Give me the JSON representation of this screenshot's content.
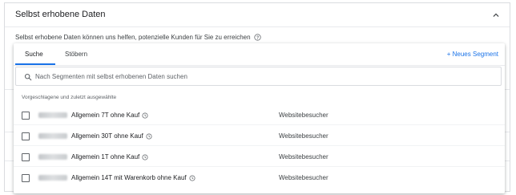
{
  "panel": {
    "title": "Selbst erhobene Daten",
    "description": "Selbst erhobene Daten können uns helfen, potenzielle Kunden für Sie zu erreichen"
  },
  "tabs": [
    {
      "label": "Suche",
      "active": true
    },
    {
      "label": "Stöbern",
      "active": false
    }
  ],
  "new_segment_label": "+ Neues Segment",
  "search": {
    "placeholder": "Nach Segmenten mit selbst erhobenen Daten suchen",
    "value": ""
  },
  "section_label": "Vorgeschlagene und zuletzt ausgewählte",
  "rows": [
    {
      "name": "Allgemein 7T ohne Kauf",
      "type": "Websitebesucher",
      "checked": false
    },
    {
      "name": "Allgemein 30T ohne Kauf",
      "type": "Websitebesucher",
      "checked": false
    },
    {
      "name": "Allgemein 1T ohne Kauf",
      "type": "Websitebesucher",
      "checked": false
    },
    {
      "name": "Allgemein 14T mit Warenkorb ohne Kauf",
      "type": "Websitebesucher",
      "checked": false
    }
  ],
  "colors": {
    "accent": "#1a73e8",
    "border": "#dadce0",
    "text": "#202124",
    "muted": "#5f6368"
  },
  "icons": {
    "collapse": "chevron-up-icon",
    "help": "help-circle-icon",
    "search": "search-icon",
    "recent": "clock-icon"
  }
}
